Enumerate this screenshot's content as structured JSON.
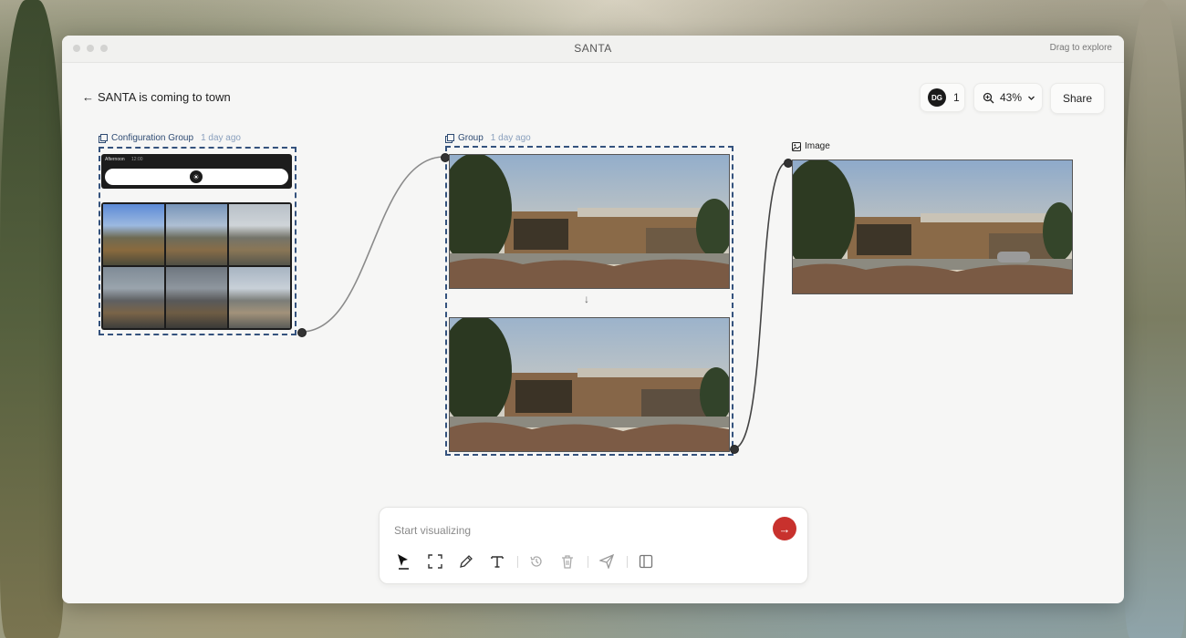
{
  "window": {
    "title": "SANTA",
    "hint": "Drag to explore"
  },
  "header": {
    "back_label": "SANTA is coming to town",
    "collaborators": {
      "initials": "DG",
      "count": "1"
    },
    "zoom": "43%",
    "share_label": "Share"
  },
  "nodes": {
    "config_group": {
      "label": "Configuration Group",
      "time": "1 day ago",
      "time_of_day": "Afternoon",
      "clock": "12:00"
    },
    "group": {
      "label": "Group",
      "time": "1 day ago",
      "arrow": "↓"
    },
    "image": {
      "label": "Image"
    }
  },
  "composer": {
    "placeholder": "Start visualizing",
    "tools": [
      "select-icon",
      "frame-icon",
      "pen-icon",
      "text-icon",
      "history-icon",
      "trash-icon",
      "send-plane-icon",
      "panel-icon"
    ]
  },
  "colors": {
    "accent": "#c8312d",
    "selection": "#34527d"
  }
}
